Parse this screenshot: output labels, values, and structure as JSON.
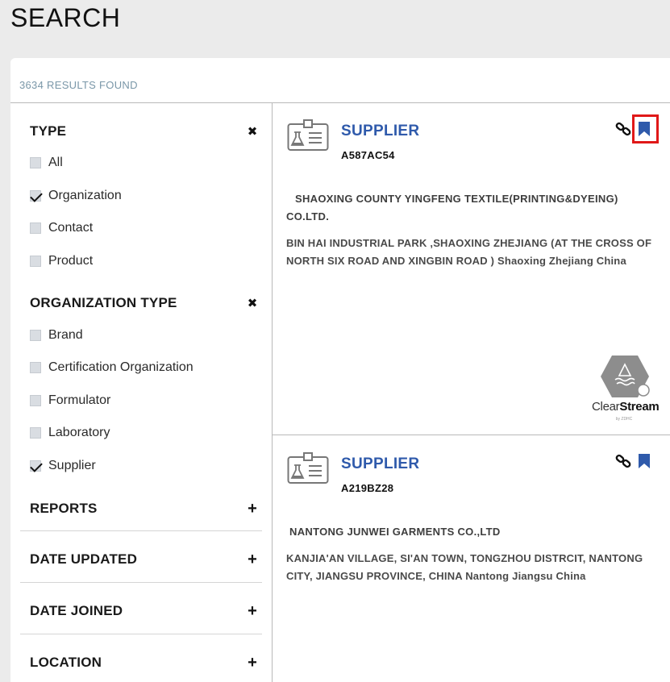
{
  "page": {
    "title": "SEARCH"
  },
  "results": {
    "count_text": "3634 RESULTS FOUND"
  },
  "filters": {
    "type": {
      "title": "TYPE",
      "options": [
        {
          "label": "All",
          "checked": false
        },
        {
          "label": "Organization",
          "checked": true
        },
        {
          "label": "Contact",
          "checked": false
        },
        {
          "label": "Product",
          "checked": false
        }
      ]
    },
    "organization_type": {
      "title": "ORGANIZATION TYPE",
      "options": [
        {
          "label": "Brand",
          "checked": false
        },
        {
          "label": "Certification Organization",
          "checked": false
        },
        {
          "label": "Formulator",
          "checked": false
        },
        {
          "label": "Laboratory",
          "checked": false
        },
        {
          "label": "Supplier",
          "checked": true
        }
      ]
    },
    "collapsed": [
      {
        "title": "REPORTS"
      },
      {
        "title": "DATE UPDATED"
      },
      {
        "title": "DATE JOINED"
      },
      {
        "title": "LOCATION"
      }
    ]
  },
  "cards": [
    {
      "title": "SUPPLIER",
      "code": "A587AC54",
      "name": "SHAOXING COUNTY YINGFENG TEXTILE(PRINTING&DYEING) CO.LTD.",
      "address": "BIN HAI INDUSTRIAL PARK ,SHAOXING ZHEJIANG (AT THE CROSS OF NORTH SIX ROAD AND XINGBIN ROAD ) Shaoxing Zhejiang China",
      "badge": {
        "text_light": "Clear",
        "text_bold": "Stream",
        "sub": "by ZDHC"
      },
      "bookmark_highlighted": true
    },
    {
      "title": "SUPPLIER",
      "code": "A219BZ28",
      "name": "NANTONG JUNWEI GARMENTS CO.,LTD",
      "address": "KANJIA'AN VILLAGE, SI'AN TOWN, TONGZHOU DISTRCIT, NANTONG CITY, JIANGSU PROVINCE, CHINA Nantong Jiangsu China",
      "bookmark_highlighted": false
    }
  ],
  "colors": {
    "accent": "#2f5aab",
    "highlight": "#e01818",
    "count": "#7a97a8"
  },
  "icons": [
    "lab-badge-icon",
    "link-icon",
    "bookmark-icon",
    "close-icon",
    "plus-icon",
    "clearstream-logo"
  ]
}
